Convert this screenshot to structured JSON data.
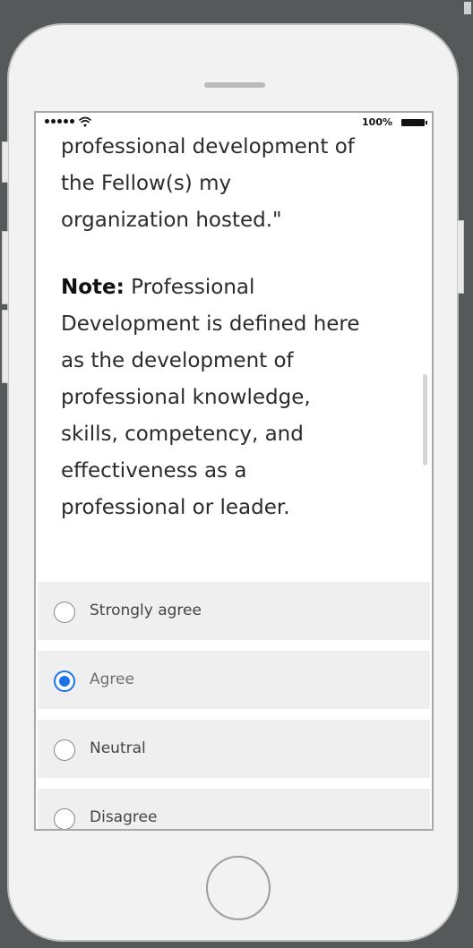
{
  "status_bar": {
    "battery_percent": "100%"
  },
  "question": {
    "lines": [
      "professional development of",
      "the Fellow(s) my",
      "organization hosted.\""
    ],
    "note_label": "Note:",
    "note_lines": [
      " Professional",
      "Development is defined here",
      "as the development of",
      "professional knowledge,",
      "skills, competency, and",
      "effectiveness as a",
      "professional or leader."
    ]
  },
  "options": [
    {
      "label": "Strongly agree",
      "selected": false
    },
    {
      "label": "Agree",
      "selected": true
    },
    {
      "label": "Neutral",
      "selected": false
    },
    {
      "label": "Disagree",
      "selected": false
    }
  ],
  "icons": {
    "wifi": "wifi-icon",
    "battery": "battery-icon",
    "signal": "signal-dots-icon",
    "home": "home-button-icon"
  },
  "colors": {
    "accent": "#1a73e8",
    "background": "#55595a",
    "phone_body": "#f2f2f2",
    "option_row": "#efefef"
  }
}
